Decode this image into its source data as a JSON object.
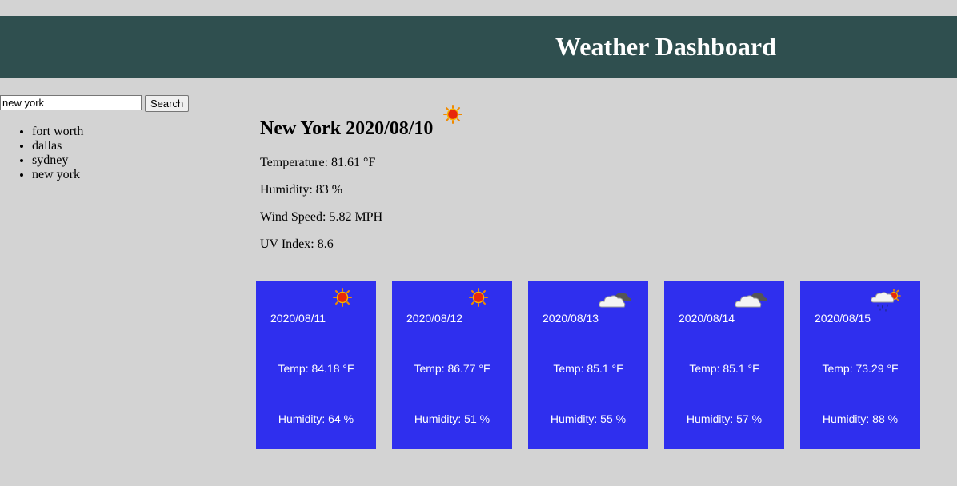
{
  "header": {
    "title": "Weather Dashboard"
  },
  "search": {
    "value": "new york",
    "button_label": "Search"
  },
  "history": [
    "fort worth",
    "dallas",
    "sydney",
    "new york"
  ],
  "current": {
    "title": "New York 2020/08/10",
    "icon": "sun-icon",
    "temperature": "Temperature: 81.61 °F",
    "humidity": "Humidity: 83 %",
    "wind": "Wind Speed: 5.82 MPH",
    "uv": "UV Index: 8.6"
  },
  "forecast": [
    {
      "date": "2020/08/11",
      "icon": "sun-icon",
      "temp": "Temp: 84.18 °F",
      "humidity": "Humidity: 64 %"
    },
    {
      "date": "2020/08/12",
      "icon": "sun-icon",
      "temp": "Temp: 86.77 °F",
      "humidity": "Humidity: 51 %"
    },
    {
      "date": "2020/08/13",
      "icon": "cloudy-icon",
      "temp": "Temp: 85.1 °F",
      "humidity": "Humidity: 55 %"
    },
    {
      "date": "2020/08/14",
      "icon": "cloudy-icon",
      "temp": "Temp: 85.1 °F",
      "humidity": "Humidity: 57 %"
    },
    {
      "date": "2020/08/15",
      "icon": "rain-sun-icon",
      "temp": "Temp: 73.29 °F",
      "humidity": "Humidity: 88 %"
    }
  ],
  "colors": {
    "header_bg": "#2f4f4f",
    "card_bg": "#2f2fee",
    "page_bg": "#d3d3d3"
  }
}
